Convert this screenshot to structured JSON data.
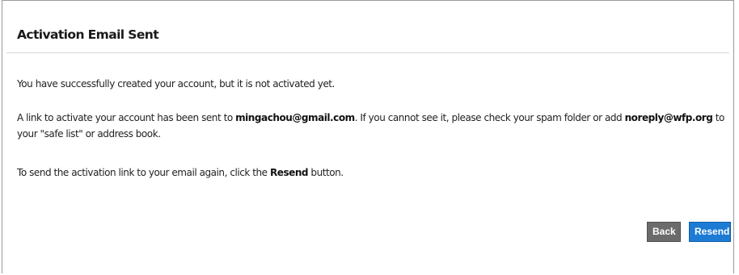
{
  "dialog": {
    "title": "Activation Email Sent",
    "paragraph1": "You have successfully created your account, but it is not activated yet.",
    "paragraph2": {
      "text_a": "A link to activate your account has been sent to ",
      "email": "mingachou@gmail.com",
      "text_b": ". If you cannot see it, please check your spam folder or add ",
      "noreply": "noreply@wfp.org",
      "text_c": " to your \"safe list\" or address book."
    },
    "paragraph3": {
      "text_a": "To send the activation link to your email again, click the ",
      "bold": "Resend",
      "text_b": " button."
    }
  },
  "buttons": {
    "back_label": "Back",
    "resend_label": "Resend"
  },
  "colors": {
    "back_button": "#6b6b6b",
    "resend_button": "#1d7bd4",
    "border": "#9a9a9a"
  }
}
